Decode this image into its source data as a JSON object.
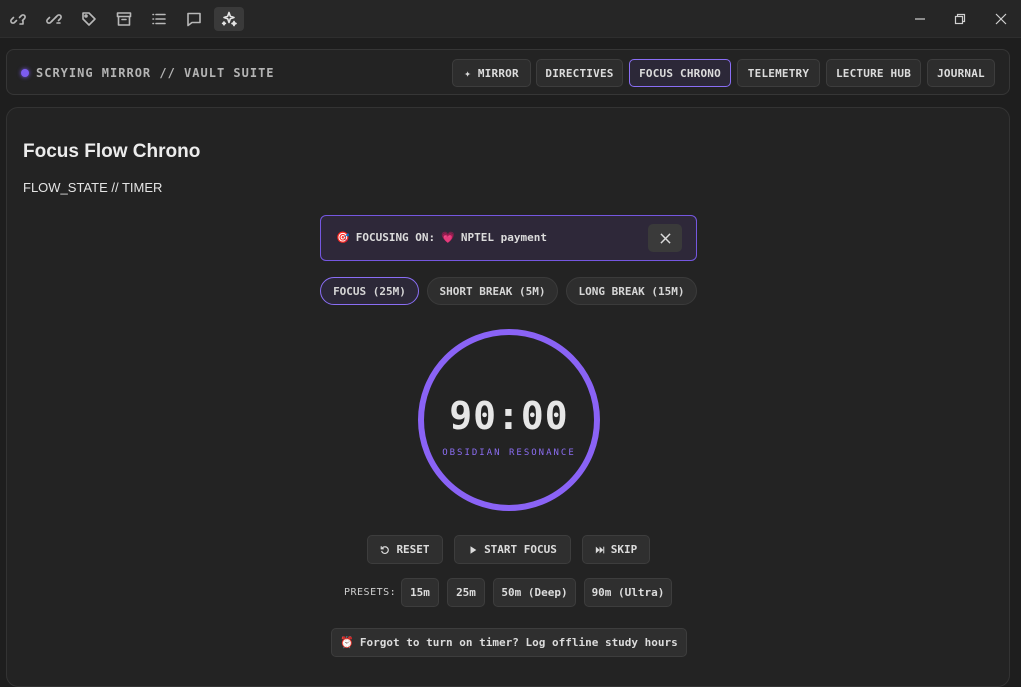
{
  "titlebar": {
    "icons": [
      "unlink-icon",
      "link-share-icon",
      "tag-icon",
      "archive-icon",
      "list-icon",
      "comment-icon",
      "sparkles-icon"
    ],
    "window_controls": [
      "minimize-icon",
      "restore-icon",
      "close-icon"
    ]
  },
  "header": {
    "brand": "SCRYING MIRROR // VAULT SUITE",
    "nav": [
      {
        "label": "✦ MIRROR",
        "active": false
      },
      {
        "label": "DIRECTIVES",
        "active": false
      },
      {
        "label": "FOCUS CHRONO",
        "active": true
      },
      {
        "label": "TELEMETRY",
        "active": false
      },
      {
        "label": "LECTURE HUB",
        "active": false
      },
      {
        "label": "JOURNAL",
        "active": false
      }
    ]
  },
  "main": {
    "title": "Focus Flow Chrono",
    "subtitle": "FLOW_STATE // TIMER",
    "focus_banner": {
      "icon": "🎯",
      "prefix": "FOCUSING ON:",
      "task_icon": "💗",
      "task": "NPTEL payment"
    },
    "modes": [
      {
        "label": "FOCUS (25M)",
        "active": true
      },
      {
        "label": "SHORT BREAK (5M)",
        "active": false
      },
      {
        "label": "LONG BREAK (15M)",
        "active": false
      }
    ],
    "timer": {
      "time": "90:00",
      "label": "OBSIDIAN RESONANCE",
      "progress": 1.0
    },
    "controls": {
      "reset": "RESET",
      "start": "START FOCUS",
      "skip": "SKIP"
    },
    "presets": {
      "label": "PRESETS:",
      "items": [
        "15m",
        "25m",
        "50m (Deep)",
        "90m (Ultra)"
      ]
    },
    "offline": {
      "icon": "⏰",
      "label": "Forgot to turn on timer? Log offline study hours"
    }
  },
  "colors": {
    "accent": "#8a63f6",
    "background": "#1e1e1e",
    "panel": "#232323"
  }
}
